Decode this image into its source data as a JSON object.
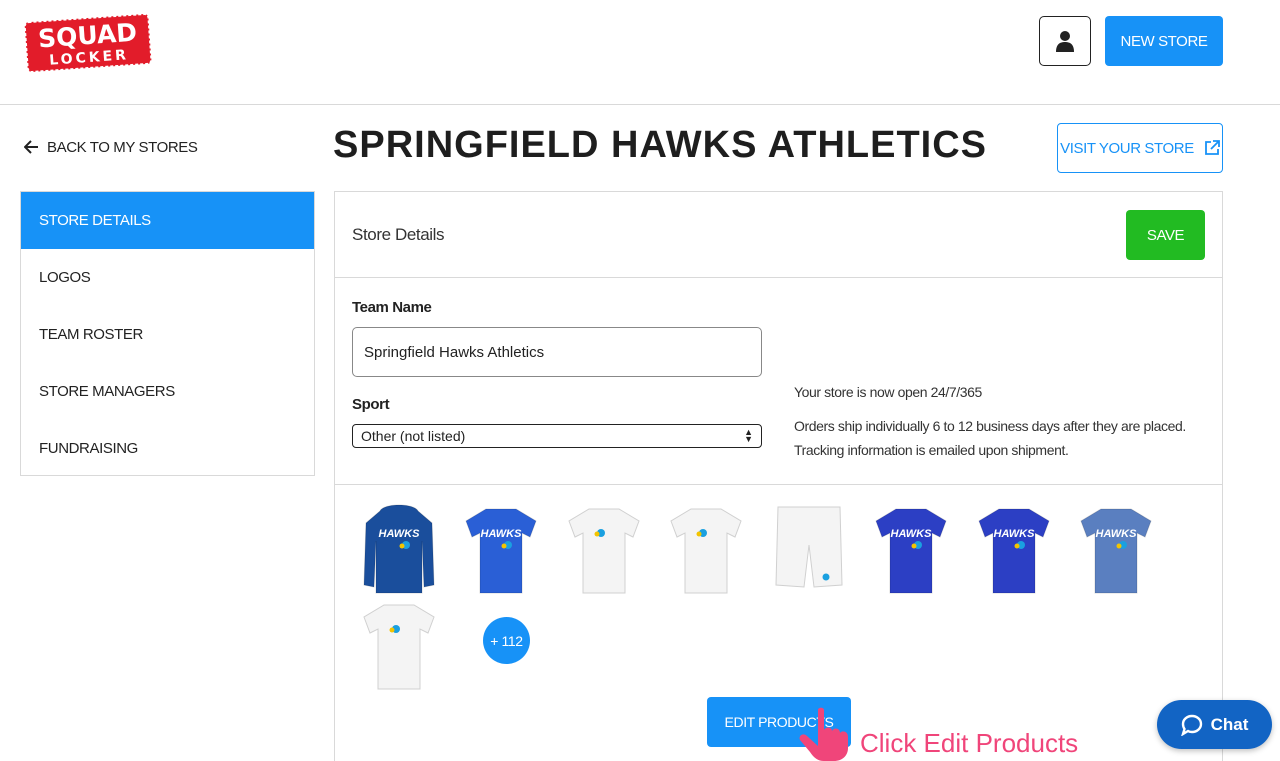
{
  "brand": {
    "logo_line1": "SQUAD",
    "logo_line2": "LOCKER",
    "logo_color": "#e21c2a"
  },
  "header": {
    "new_store_label": "NEW STORE",
    "account_icon": "user-icon"
  },
  "nav": {
    "back_label": "BACK TO MY STORES",
    "back_icon": "arrow-left-icon"
  },
  "page": {
    "title": "SPRINGFIELD HAWKS ATHLETICS",
    "visit_label": "VISIT YOUR STORE",
    "visit_icon": "external-link-icon"
  },
  "sidebar": {
    "items": [
      {
        "label": "STORE DETAILS",
        "active": true
      },
      {
        "label": "LOGOS",
        "active": false
      },
      {
        "label": "TEAM ROSTER",
        "active": false
      },
      {
        "label": "STORE MANAGERS",
        "active": false
      },
      {
        "label": "FUNDRAISING",
        "active": false
      }
    ]
  },
  "panel": {
    "title": "Store Details",
    "save_label": "SAVE",
    "team_name_label": "Team Name",
    "team_name_value": "Springfield Hawks Athletics",
    "sport_label": "Sport",
    "sport_value": "Other (not listed)",
    "info_line1": "Your store is now open 24/7/365",
    "info_line2": "Orders ship individually 6 to 12 business days after they are placed.",
    "info_line3": "Tracking information is emailed upon shipment."
  },
  "products": {
    "items": [
      {
        "name": "hoodie-navy",
        "color": "#1a4e9c",
        "text": "HAWKS"
      },
      {
        "name": "womens-tee-royal",
        "color": "#2a5fd6",
        "text": "HAWKS"
      },
      {
        "name": "womens-tee-white",
        "color": "#f4f4f4",
        "text": ""
      },
      {
        "name": "tee-white",
        "color": "#f4f4f4",
        "text": ""
      },
      {
        "name": "shorts-white",
        "color": "#f4f4f4",
        "text": ""
      },
      {
        "name": "womens-tee-royal-2",
        "color": "#2c3fc4",
        "text": "HAWKS"
      },
      {
        "name": "tee-royal",
        "color": "#2c3fc4",
        "text": "HAWKS"
      },
      {
        "name": "tee-heather-blue",
        "color": "#5a7fc0",
        "text": "HAWKS"
      },
      {
        "name": "tee-white-2",
        "color": "#f4f4f4",
        "text": ""
      }
    ],
    "more_label": "+ 112",
    "edit_label": "EDIT PRODUCTS"
  },
  "annotation": {
    "text": "Click Edit Products",
    "color": "#f0457a"
  },
  "chat": {
    "label": "Chat"
  },
  "colors": {
    "primary": "#1792f7",
    "save": "#22bb22",
    "chat": "#1264c4"
  }
}
